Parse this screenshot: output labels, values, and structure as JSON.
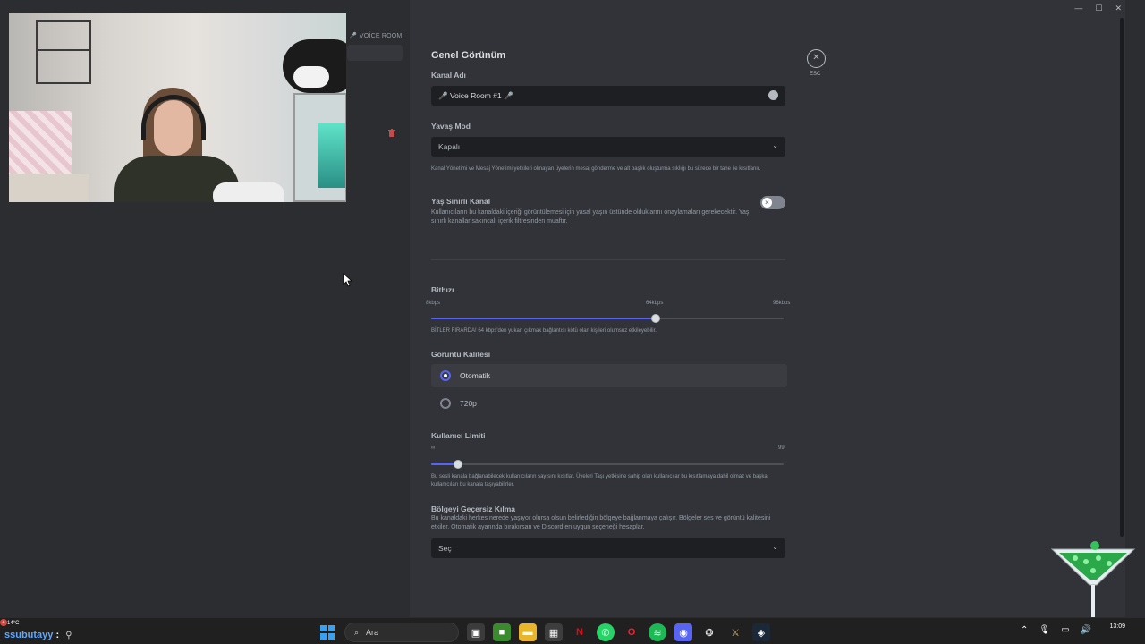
{
  "sidebar": {
    "voice_room_label": "VOİCE ROOM"
  },
  "settings": {
    "title": "Genel Görünüm",
    "close_label": "ESC",
    "channel_name": {
      "label": "Kanal Adı",
      "value": "🎤 Voice Room #1 🎤"
    },
    "slow_mode": {
      "label": "Yavaş Mod",
      "value": "Kapalı",
      "help": "Kanal Yönetimi ve Mesaj Yönetimi yetkileri olmayan üyelerin mesaj gönderme ve alt başlık oluşturma sıklığı bu sürede bir tane ile kısıtlanır."
    },
    "age_restricted": {
      "label": "Yaş Sınırlı Kanal",
      "help": "Kullanıcıların bu kanaldaki içeriği görüntülemesi için yasal yaşın üstünde olduklarını onaylamaları gerekecektir. Yaş sınırlı kanallar sakıncalı içerik filtresinden muaftır.",
      "enabled": false
    },
    "bitrate": {
      "label": "Bithızı",
      "min_label": "8kbps",
      "mid_label": "64kbps",
      "max_label": "96kbps",
      "value_kbps": 64,
      "min_kbps": 8,
      "max_kbps": 96,
      "help": "BİTLER FIRARDA! 64 kbps'den yukarı çıkmak bağlantısı kötü olan kişileri olumsuz etkileyebilir."
    },
    "video_quality": {
      "label": "Görüntü Kalitesi",
      "options": [
        "Otomatik",
        "720p"
      ],
      "selected": "Otomatik"
    },
    "user_limit": {
      "label": "Kullanıcı Limiti",
      "min_label": "∞",
      "max_label": "99",
      "value": 0,
      "help": "Bu sesli kanala bağlanabilecek kullanıcıların sayısını kısıtlar. Üyeleri Taşı yetkisine sahip olan kullanıcılar bu kısıtlamaya dahil olmaz ve başka kullanıcıları bu kanala taşıyabilirler."
    },
    "region_override": {
      "label": "Bölgeyi Geçersiz Kılma",
      "help": "Bu kanaldaki herkes nerede yaşıyor olursa olsun belirlediğin bölgeye bağlanmaya çalışır. Bölgeler ses ve görüntü kalitesini etkiler. Otomatik ayarında bırakırsan ve Discord en uygun seçeneği hesaplar.",
      "value": "Seç"
    }
  },
  "taskbar": {
    "weather": "14°C",
    "weather_badge": "4",
    "chat_username": "ssubutayy",
    "chat_colon": ":",
    "search_placeholder": "Ara",
    "clock_time": "13:09",
    "icons": [
      "windows-start-icon",
      "task-view-icon",
      "minecraft-icon",
      "file-explorer-icon",
      "store-icon",
      "netflix-icon",
      "whatsapp-icon",
      "opera-icon",
      "spotify-icon",
      "discord-icon",
      "chatgpt-icon",
      "league-icon",
      "steam-icon"
    ]
  },
  "colors": {
    "accent": "#5865f2",
    "panel_bg": "#313338",
    "sidebar_bg": "#2b2d31",
    "input_bg": "#1e1f22"
  }
}
